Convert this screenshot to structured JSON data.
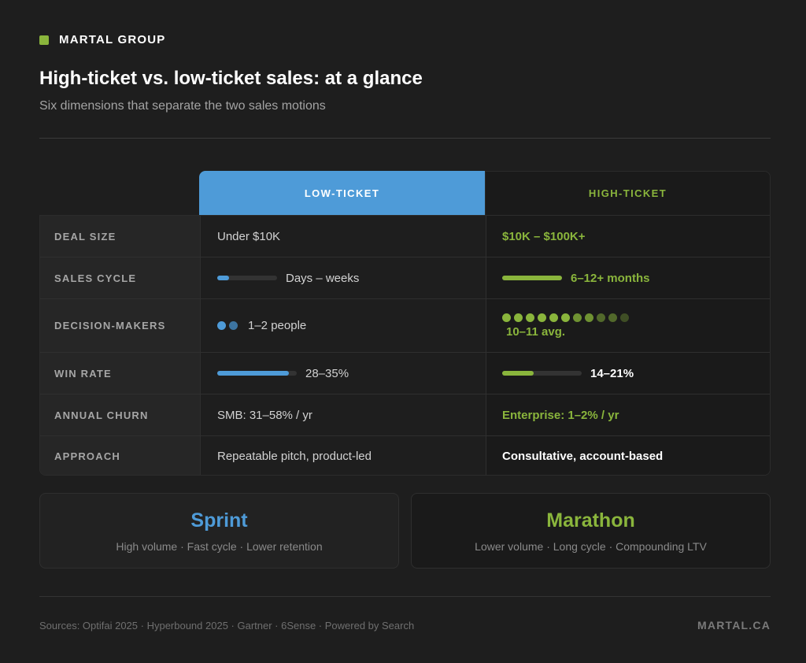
{
  "brand": {
    "name": "MARTAL GROUP",
    "accent": "#8ab53c"
  },
  "header": {
    "title": "High-ticket vs. low-ticket sales: at a glance",
    "subtitle": "Six dimensions that separate the two sales motions"
  },
  "table": {
    "columns": {
      "low": "LOW-TICKET",
      "high": "HIGH-TICKET"
    },
    "colors": {
      "low": "#4e9bd8",
      "high": "#8ab53c"
    },
    "rows": [
      {
        "label": "DEAL SIZE",
        "low": "Under $10K",
        "high": "$10K – $100K+"
      },
      {
        "label": "SALES CYCLE",
        "low": "Days – weeks",
        "high": "6–12+ months",
        "low_level": 0.2,
        "high_level": 1.0
      },
      {
        "label": "DECISION-MAKERS",
        "low": "1–2 people",
        "high": "10–11 avg.",
        "low_count": 2,
        "high_count": 11
      },
      {
        "label": "WIN RATE",
        "low": "28–35%",
        "high": "14–21%",
        "low_level": 0.9,
        "high_level": 0.4
      },
      {
        "label": "ANNUAL CHURN",
        "low": "SMB: 31–58% / yr",
        "high": "Enterprise: 1–2% / yr"
      },
      {
        "label": "APPROACH",
        "low": "Repeatable pitch, product-led",
        "high": "Consultative, account-based"
      }
    ]
  },
  "cards": {
    "sprint": {
      "title": "Sprint",
      "subtitle": "High volume · Fast cycle · Lower retention"
    },
    "marathon": {
      "title": "Marathon",
      "subtitle": "Lower volume · Long cycle · Compounding LTV"
    }
  },
  "footer": {
    "sources": "Sources: Optifai 2025 · Hyperbound 2025 · Gartner · 6Sense · Powered by Search",
    "site": "MARTAL.CA"
  }
}
